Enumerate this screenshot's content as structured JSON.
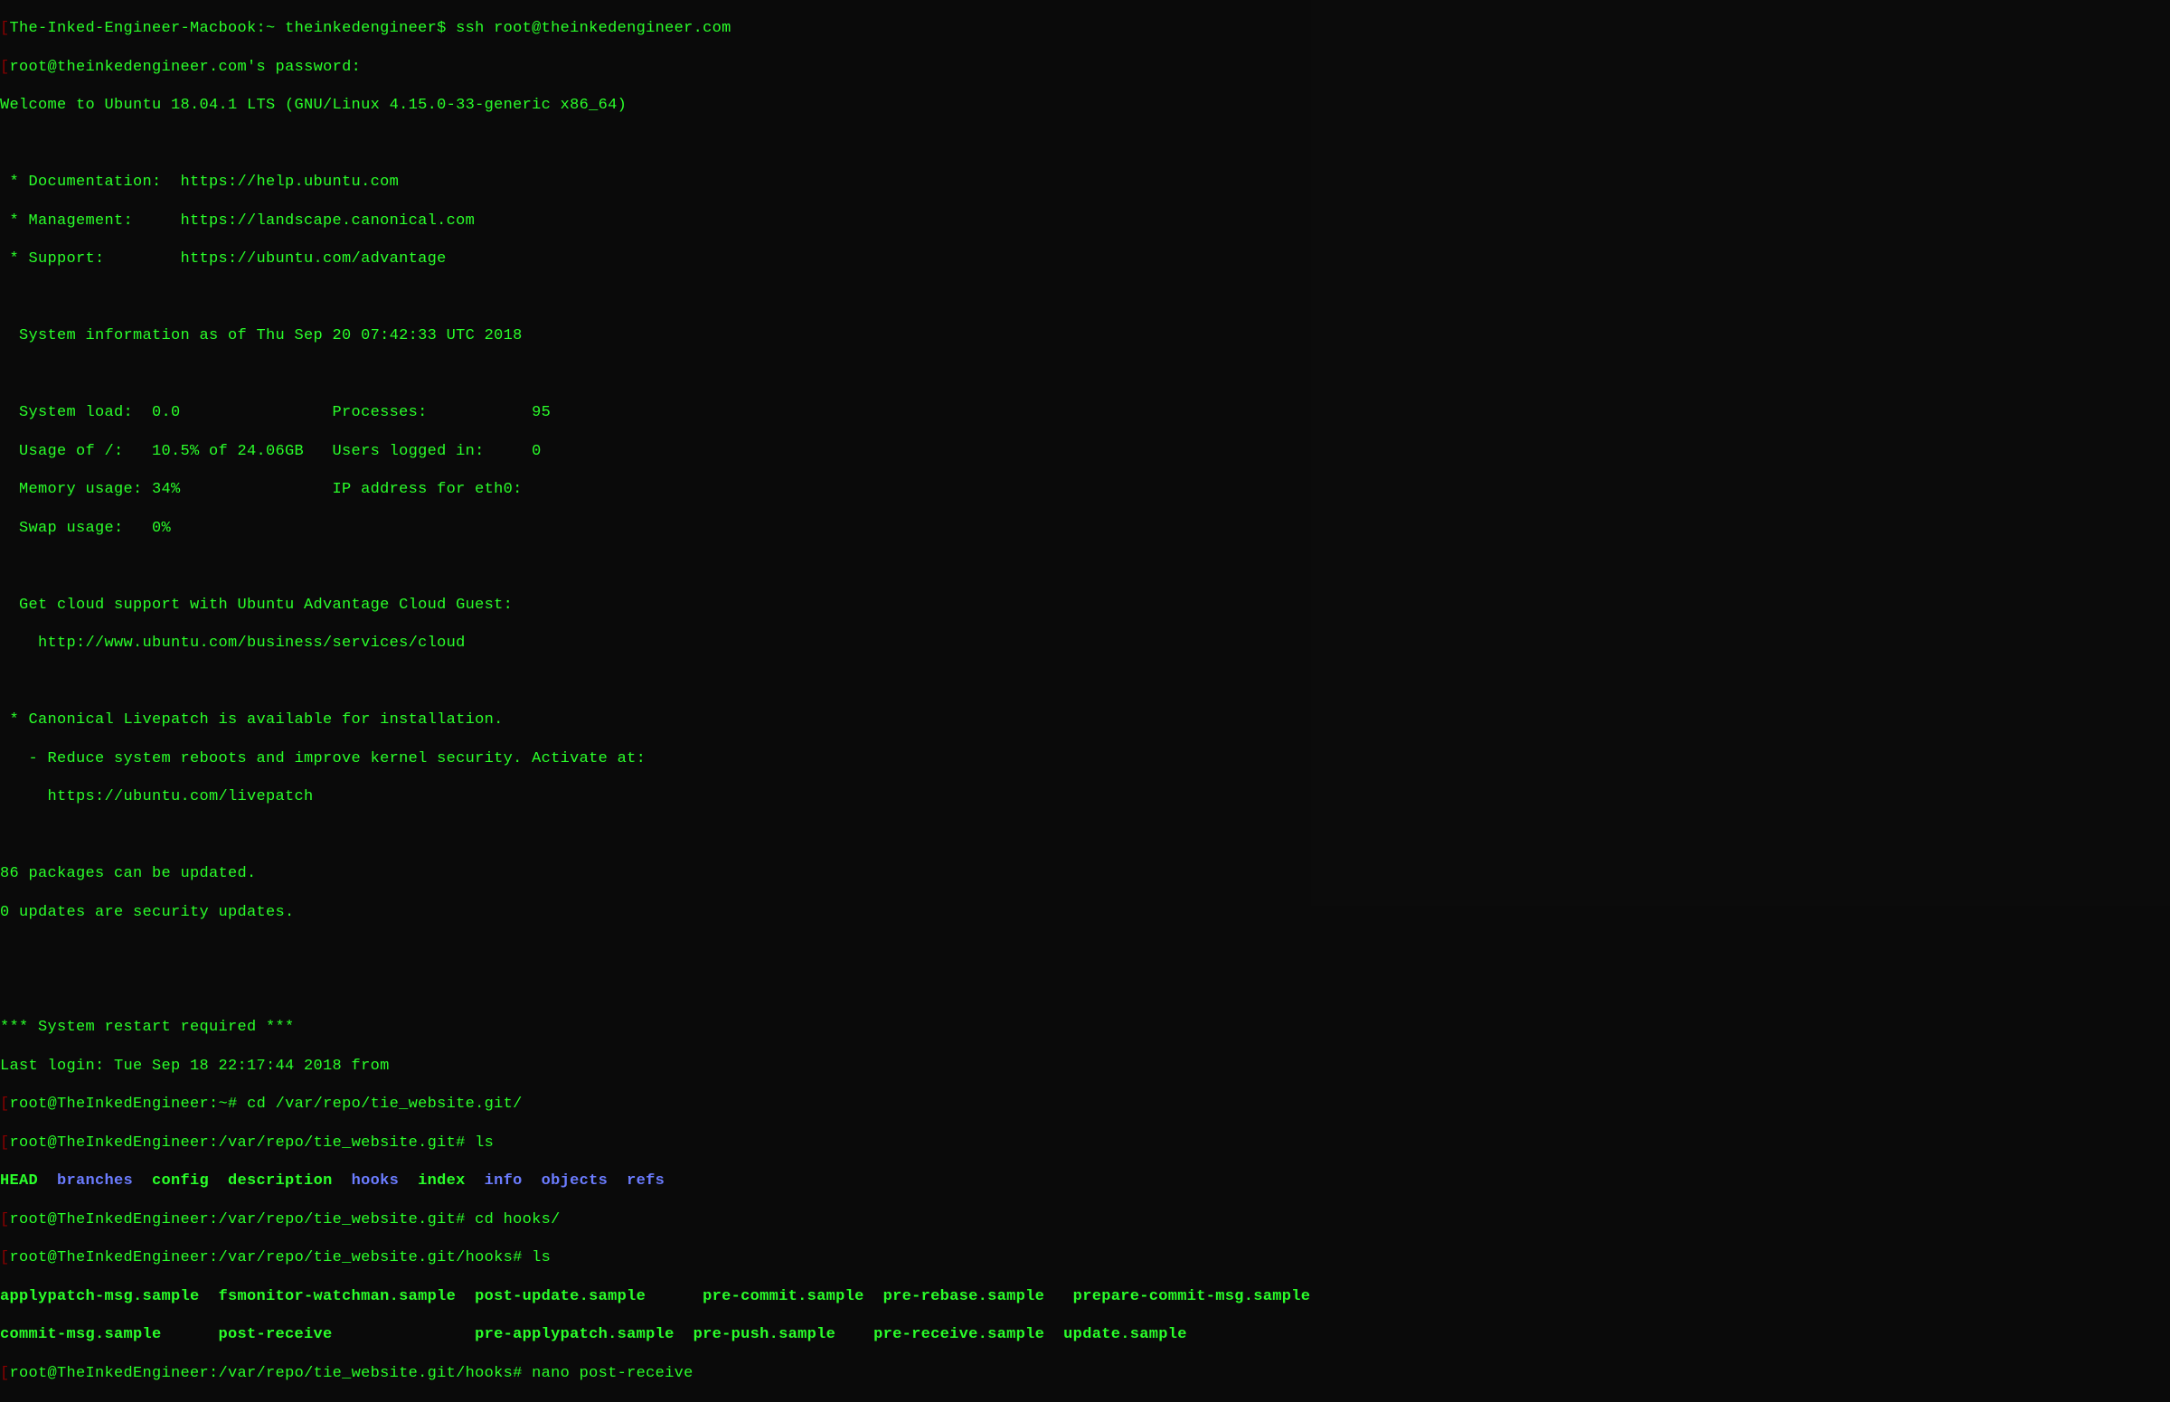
{
  "terminal": {
    "host_prompt_prefix": "[",
    "mac_host": "The-Inked-Engineer-Macbook:~ theinkedengineer$",
    "ssh_command": " ssh root@theinkedengineer.com",
    "pw_prompt": "root@theinkedengineer.com's password:",
    "welcome": "Welcome to Ubuntu 18.04.1 LTS (GNU/Linux 4.15.0-33-generic x86_64)",
    "doc_line": " * Documentation:  https://help.ubuntu.com",
    "mgmt_line": " * Management:     https://landscape.canonical.com",
    "support_line": " * Support:        https://ubuntu.com/advantage",
    "sysinfo_header": "  System information as of Thu Sep 20 07:42:33 UTC 2018",
    "sys_load": "  System load:  0.0                Processes:           95",
    "usage": "  Usage of /:   10.5% of 24.06GB   Users logged in:     0",
    "mem": "  Memory usage: 34%                IP address for eth0:",
    "swap": "  Swap usage:   0%",
    "cloud1": "  Get cloud support with Ubuntu Advantage Cloud Guest:",
    "cloud2": "    http://www.ubuntu.com/business/services/cloud",
    "livepatch1": " * Canonical Livepatch is available for installation.",
    "livepatch2": "   - Reduce system reboots and improve kernel security. Activate at:",
    "livepatch3": "     https://ubuntu.com/livepatch",
    "pkg_updates": "86 packages can be updated.",
    "sec_updates": "0 updates are security updates.",
    "restart": "*** System restart required ***",
    "last_login": "Last login: Tue Sep 18 22:17:44 2018 from",
    "prompt1_host": "root@TheInkedEngineer:~#",
    "prompt1_cmd": " cd /var/repo/tie_website.git/",
    "prompt2_host": "root@TheInkedEngineer:/var/repo/tie_website.git#",
    "prompt2_cmd": " ls",
    "ls1_parts": {
      "head": "HEAD  ",
      "branches": "branches",
      "gap1": "  config  description  ",
      "hooks": "hooks",
      "gap2": "  index  ",
      "info": "info",
      "gap3": "  ",
      "objects": "objects",
      "gap4": "  ",
      "refs": "refs"
    },
    "prompt3_host": "root@TheInkedEngineer:/var/repo/tie_website.git#",
    "prompt3_cmd": " cd hooks/",
    "prompt4_host": "root@TheInkedEngineer:/var/repo/tie_website.git/hooks#",
    "prompt4_cmd": " ls",
    "hooks_row1": "applypatch-msg.sample  fsmonitor-watchman.sample  post-update.sample      pre-commit.sample  pre-rebase.sample   prepare-commit-msg.sample",
    "hooks_row2": "commit-msg.sample      post-receive               pre-applypatch.sample  pre-push.sample    pre-receive.sample  update.sample",
    "prompt5_host": "root@TheInkedEngineer:/var/repo/tie_website.git/hooks#",
    "prompt5_cmd": " nano post-receive"
  }
}
